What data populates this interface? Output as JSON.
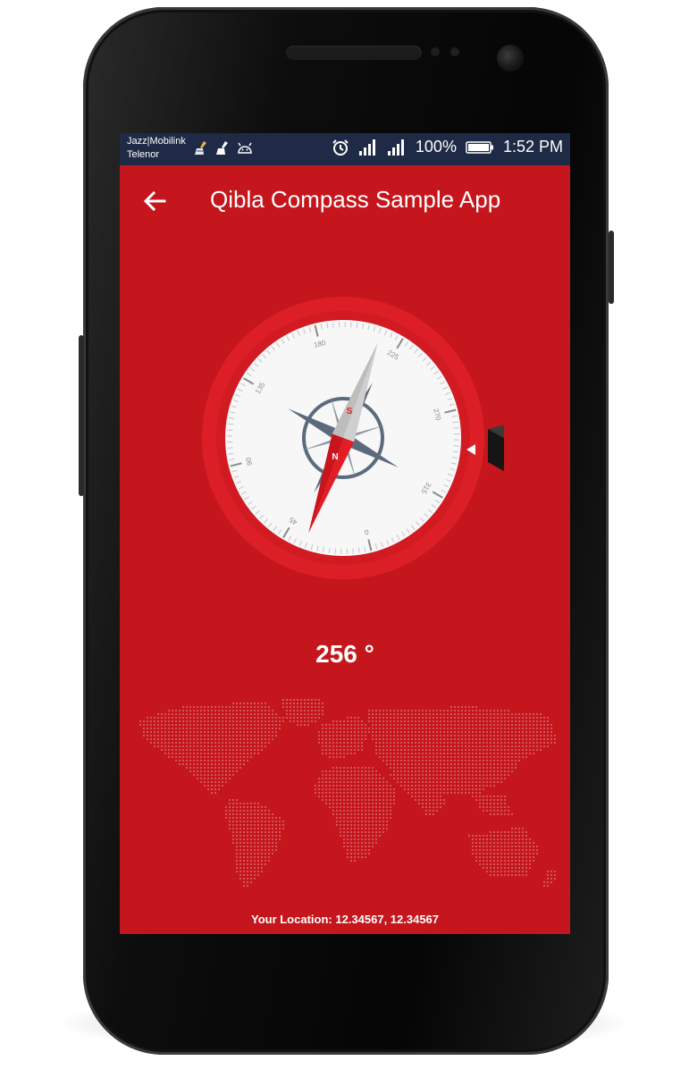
{
  "status_bar": {
    "carrier_1": "Jazz|Mobilink",
    "carrier_2": "Telenor",
    "battery": "100%",
    "time": "1:52 PM",
    "icons_left": [
      "cleaner-broom-icon",
      "cleaner-broom-icon",
      "android-icon"
    ],
    "icons_right": [
      "alarm-icon",
      "signal-icon",
      "signal-icon",
      "battery-icon"
    ]
  },
  "toolbar": {
    "title": "Qibla Compass Sample App",
    "back_icon": "arrow-left-icon"
  },
  "compass": {
    "scale_labels": [
      "0",
      "45",
      "90",
      "135",
      "180",
      "225",
      "270",
      "315"
    ],
    "needle_north": "N",
    "needle_south": "S",
    "qibla_marker": "kaaba-icon"
  },
  "qibla": {
    "degree": "256 °"
  },
  "footer": {
    "location": "Your Location: 12.34567, 12.34567"
  },
  "colors": {
    "screen_bg": "#c4161c",
    "ring": "#dc1f26",
    "status_bar": "#1f2a46",
    "needle_red": "#e11d26",
    "needle_grey": "#c9c9c9"
  }
}
